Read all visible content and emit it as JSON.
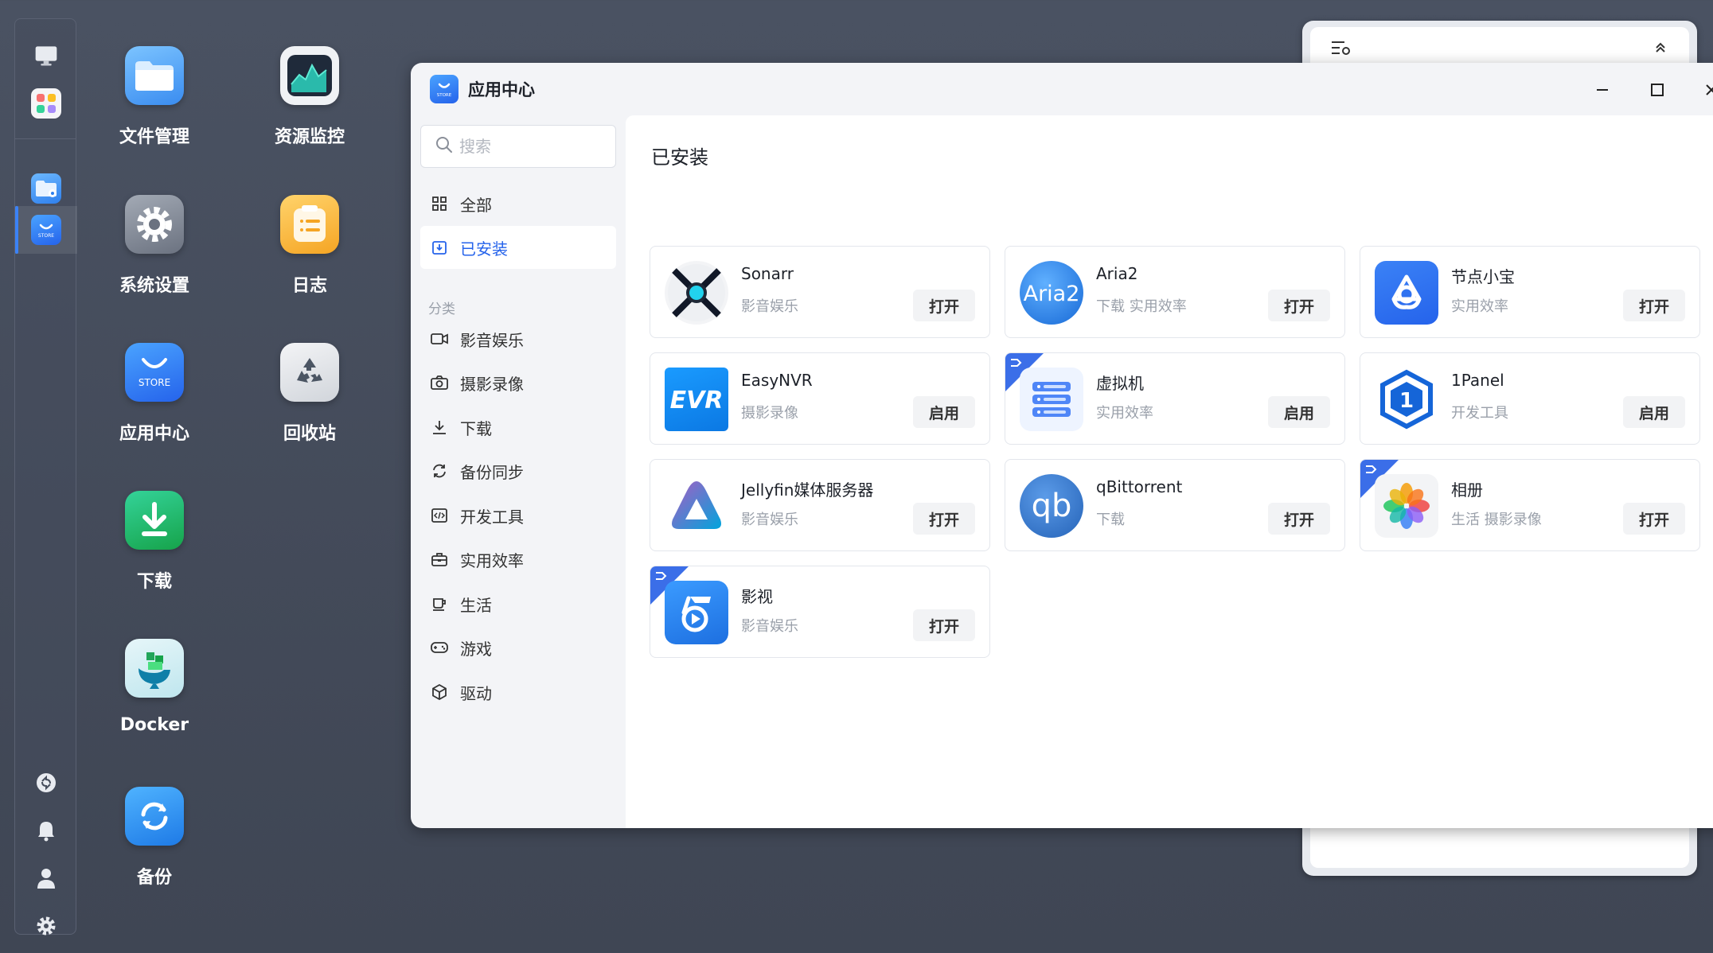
{
  "desktop": {
    "icons": [
      {
        "label": "文件管理",
        "icon": "folder-icon"
      },
      {
        "label": "资源监控",
        "icon": "monitor-chart-icon"
      },
      {
        "label": "系统设置",
        "icon": "gear-icon"
      },
      {
        "label": "日志",
        "icon": "log-icon"
      },
      {
        "label": "应用中心",
        "icon": "store-icon"
      },
      {
        "label": "回收站",
        "icon": "recycle-icon"
      },
      {
        "label": "下载",
        "icon": "download-icon"
      },
      {
        "label": "Docker",
        "icon": "docker-icon"
      },
      {
        "label": "备份",
        "icon": "backup-icon"
      }
    ],
    "store_badge_text": "STORE"
  },
  "window": {
    "title": "应用中心",
    "title_icon": "store-icon"
  },
  "sidebar": {
    "search_placeholder": "搜索",
    "top_items": [
      {
        "label": "全部",
        "icon": "grid-icon"
      },
      {
        "label": "已安装",
        "icon": "installed-icon"
      }
    ],
    "section_label": "分类",
    "categories": [
      {
        "label": "影音娱乐",
        "icon": "video-icon"
      },
      {
        "label": "摄影录像",
        "icon": "camera-icon"
      },
      {
        "label": "下载",
        "icon": "download-icon"
      },
      {
        "label": "备份同步",
        "icon": "sync-icon"
      },
      {
        "label": "开发工具",
        "icon": "code-icon"
      },
      {
        "label": "实用效率",
        "icon": "toolbox-icon"
      },
      {
        "label": "生活",
        "icon": "cup-icon"
      },
      {
        "label": "游戏",
        "icon": "gamepad-icon"
      },
      {
        "label": "驱动",
        "icon": "cube-icon"
      }
    ]
  },
  "main": {
    "title": "已安装",
    "apps": [
      {
        "name": "Sonarr",
        "category": "影音娱乐",
        "button": "打开",
        "badge": false
      },
      {
        "name": "Aria2",
        "category": "下载 实用效率",
        "button": "打开",
        "badge": false
      },
      {
        "name": "节点小宝",
        "category": "实用效率",
        "button": "打开",
        "badge": false
      },
      {
        "name": "EasyNVR",
        "category": "摄影录像",
        "button": "启用",
        "badge": false
      },
      {
        "name": "虚拟机",
        "category": "实用效率",
        "button": "启用",
        "badge": true
      },
      {
        "name": "1Panel",
        "category": "开发工具",
        "button": "启用",
        "badge": false
      },
      {
        "name": "Jellyfin媒体服务器",
        "category": "影音娱乐",
        "button": "打开",
        "badge": false
      },
      {
        "name": "qBittorrent",
        "category": "下载",
        "button": "打开",
        "badge": false
      },
      {
        "name": "相册",
        "category": "生活 摄影录像",
        "button": "打开",
        "badge": true
      },
      {
        "name": "影视",
        "category": "影音娱乐",
        "button": "打开",
        "badge": true
      }
    ],
    "icon_texts": {
      "aria2": "Aria2",
      "easynvr": "EVR",
      "qbittorrent": "qb",
      "onepanel": "1"
    }
  },
  "colors": {
    "accent": "#2563eb",
    "badge": "#3b6ee8",
    "desktop_bg": "#464d5c"
  }
}
